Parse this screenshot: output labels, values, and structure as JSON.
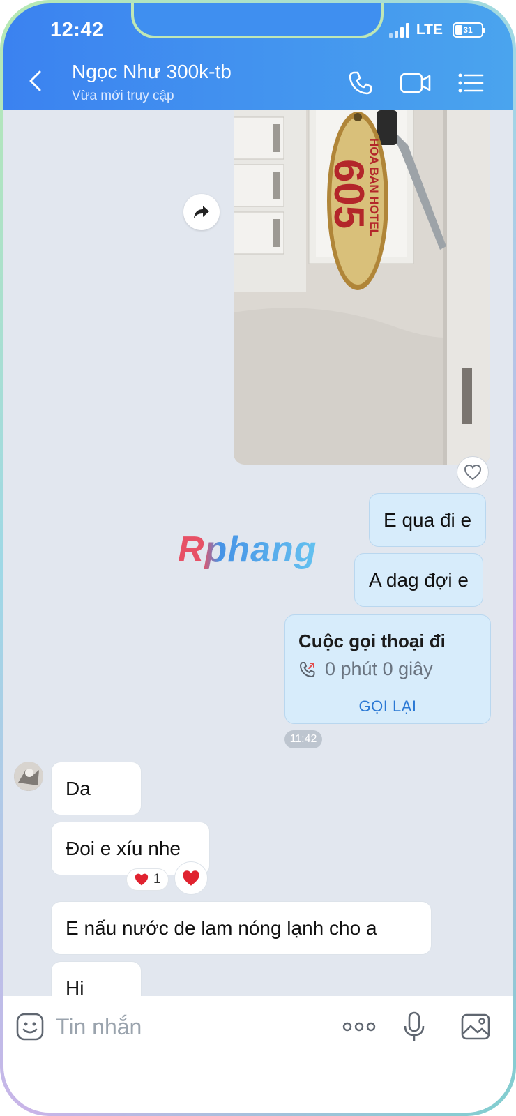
{
  "status_bar": {
    "time": "12:42",
    "network": "LTE",
    "battery": "31"
  },
  "header": {
    "title": "Ngọc Như 300k-tb",
    "subtitle": "Vừa mới truy cập",
    "back_icon": "chevron-left-icon",
    "call_icon": "phone-icon",
    "video_icon": "video-camera-icon",
    "menu_icon": "list-menu-icon"
  },
  "watermark": "Rphang",
  "photo": {
    "key_tag_line1": "HOA BAN HOTEL",
    "key_tag_line2": "605"
  },
  "messages": {
    "me_1": "E qua đi e",
    "me_2": "A dag đợi e",
    "call": {
      "title": "Cuộc gọi thoại đi",
      "duration": "0 phút 0 giây",
      "action": "GỌI LẠI"
    },
    "time": "11:42",
    "them_1": "Da",
    "them_2": "Đoi e xíu nhe",
    "them_2_reaction_count": "1",
    "them_3": "E nấu nước de lam nóng lạnh cho a",
    "them_4": "Hi"
  },
  "composer": {
    "placeholder": "Tin nhắn",
    "sticker_icon": "sticker-icon",
    "more_icon": "more-dots-icon",
    "mic_icon": "microphone-icon",
    "image_icon": "image-icon"
  },
  "colors": {
    "header_start": "#3b82f0",
    "header_end": "#4aa4ee",
    "my_bubble": "#d7ecfb",
    "chat_bg": "#e2e7ef",
    "link": "#2a78d4"
  }
}
